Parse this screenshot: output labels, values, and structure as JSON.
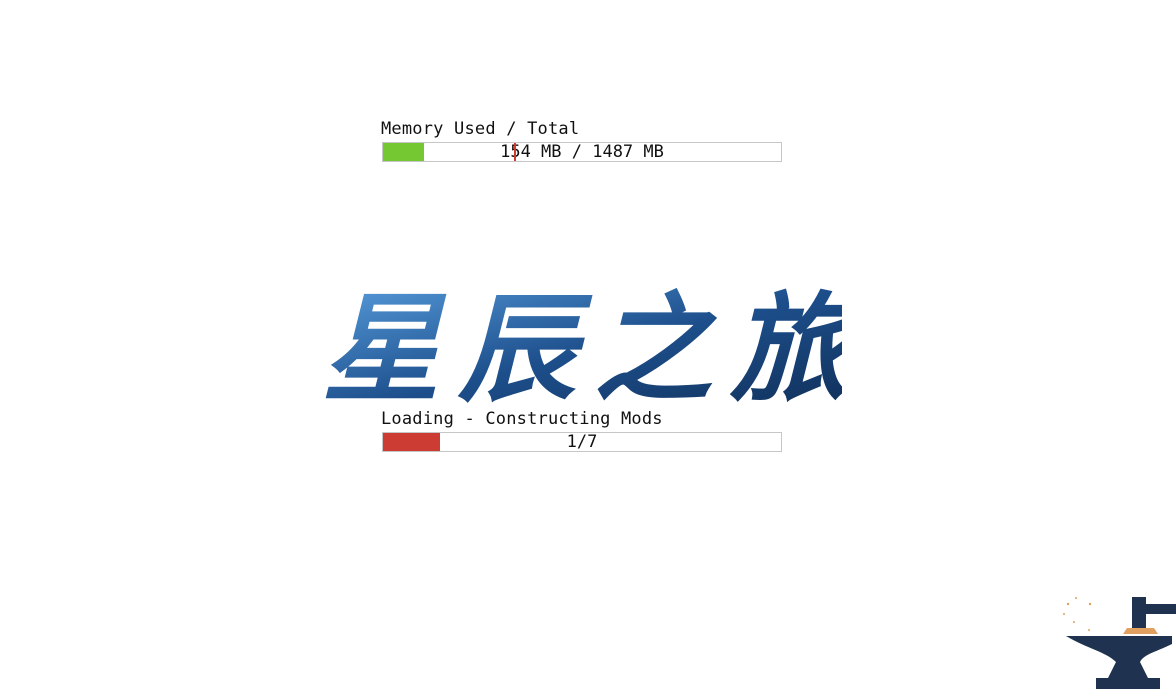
{
  "memory": {
    "label": "Memory Used / Total",
    "value_text": "154 MB / 1487 MB",
    "used_mb": 154,
    "total_mb": 1487,
    "bar_color": "#76c832"
  },
  "logo": {
    "text": "星辰之旅",
    "color_primary": "#1d4f8c",
    "color_accent": "#5aa0e0"
  },
  "loading": {
    "label": "Loading - Constructing Mods",
    "value_text": "1/7",
    "current": 1,
    "total": 7,
    "bar_color": "#cc3c33"
  },
  "branding": {
    "icon": "forge-anvil-icon",
    "color_dark": "#1f3350",
    "color_accent": "#e0a060"
  }
}
